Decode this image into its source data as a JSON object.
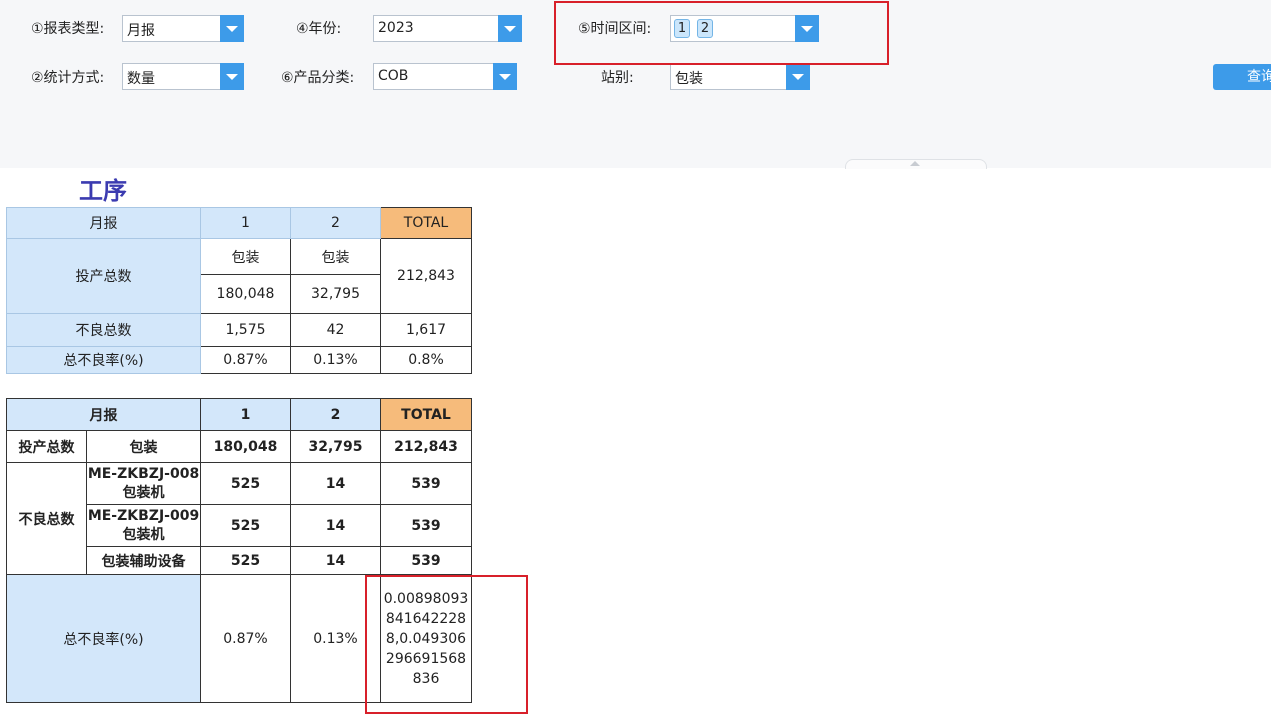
{
  "filters": {
    "report_type": {
      "label": "①报表类型:",
      "value": "月报"
    },
    "year": {
      "label": "④年份:",
      "value": "2023"
    },
    "time_range": {
      "label": "⑤时间区间:",
      "tags": [
        "1",
        "2"
      ]
    },
    "stat_method": {
      "label": "②统计方式:",
      "value": "数量"
    },
    "product_category": {
      "label": "⑥产品分类:",
      "value": "COB"
    },
    "station": {
      "label": "站别:",
      "value": "包装"
    },
    "query_button": "查询"
  },
  "section_title": "工序",
  "table1": {
    "header": [
      "月报",
      "1",
      "2",
      "TOTAL"
    ],
    "input_total": {
      "label": "投产总数",
      "stations": [
        "包装",
        "包装"
      ],
      "values": [
        "180,048",
        "32,795"
      ],
      "total": "212,843"
    },
    "defect_total": {
      "label": "不良总数",
      "values": [
        "1,575",
        "42"
      ],
      "total": "1,617"
    },
    "defect_rate": {
      "label": "总不良率(%)",
      "values": [
        "0.87%",
        "0.13%"
      ],
      "total": "0.8%"
    }
  },
  "table2": {
    "header": [
      "月报",
      "1",
      "2",
      "TOTAL"
    ],
    "input_total": {
      "label": "投产总数",
      "station": "包装",
      "values": [
        "180,048",
        "32,795"
      ],
      "total": "212,843"
    },
    "defect_total": {
      "label": "不良总数",
      "rows": [
        {
          "equipment": "ME-ZKBZJ-008包装机",
          "values": [
            "525",
            "14"
          ],
          "total": "539"
        },
        {
          "equipment": "ME-ZKBZJ-009包装机",
          "values": [
            "525",
            "14"
          ],
          "total": "539"
        },
        {
          "equipment": "包装辅助设备",
          "values": [
            "525",
            "14"
          ],
          "total": "539"
        }
      ]
    },
    "defect_rate": {
      "label": "总不良率(%)",
      "values": [
        "0.87%",
        "0.13%"
      ],
      "total": "0.008980938416422288,0.049306296691568836"
    }
  },
  "colors": {
    "accent": "#3d9be9",
    "header_bg": "#d3e7fa",
    "total_bg": "#f6bb7b",
    "highlight_box": "#d8202a",
    "title": "#3b3bb0"
  }
}
